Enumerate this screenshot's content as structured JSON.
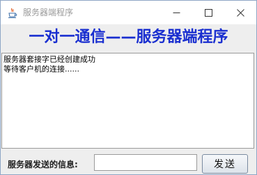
{
  "window": {
    "title": "服务器端程序",
    "banner": "一对一通信——服务器端程序"
  },
  "log": {
    "lines": [
      "服务器套接字已经创建成功",
      "等待客户机的连接......"
    ]
  },
  "send": {
    "label": "服务器发送的信息:",
    "input_value": "",
    "button_label": "发送"
  },
  "colors": {
    "banner_text": "#1a2fd0",
    "title_text": "#9a9a9a"
  },
  "icons": {
    "app": "java-cup-icon",
    "minimize": "minimize-icon",
    "maximize": "maximize-icon",
    "close": "close-icon"
  }
}
